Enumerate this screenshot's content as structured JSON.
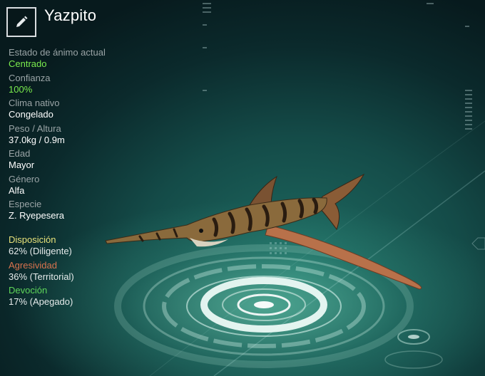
{
  "creature": {
    "name": "Yazpito"
  },
  "edit_button": {
    "icon": "pencil-icon"
  },
  "stats": [
    {
      "label": "Estado de ánimo actual",
      "value": "Centrado"
    },
    {
      "label": "Confianza",
      "value": "100%"
    },
    {
      "label": "Clima nativo",
      "value": "Congelado"
    },
    {
      "label": "Peso / Altura",
      "value": "37.0kg / 0.9m"
    },
    {
      "label": "Edad",
      "value": "Mayor"
    },
    {
      "label": "Género",
      "value": "Alfa"
    },
    {
      "label": "Especie",
      "value": "Z. Ryepesera"
    }
  ],
  "traits": [
    {
      "label": "Disposición",
      "value": "62% (Diligente)",
      "color": "#e8e27a"
    },
    {
      "label": "Agresividad",
      "value": "36% (Territorial)",
      "color": "#d9734e"
    },
    {
      "label": "Devoción",
      "value": "17% (Apegado)",
      "color": "#5fd65a"
    }
  ],
  "colors": {
    "accent_green": "#7bec4e",
    "label_gray": "#9aa4a6",
    "background_teal": "#1f6d63"
  }
}
